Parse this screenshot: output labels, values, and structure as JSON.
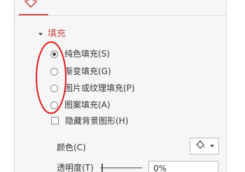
{
  "fill_section": {
    "title": "填充",
    "options": [
      {
        "label": "纯色填充(S)",
        "checked": true
      },
      {
        "label": "渐变填充(G)",
        "checked": false
      },
      {
        "label": "图片或纹理填充(P)",
        "checked": false
      },
      {
        "label": "图案填充(A)",
        "checked": false
      }
    ],
    "hide_background": {
      "label": "隐藏背景图形(H)",
      "checked": false
    }
  },
  "color": {
    "label": "颜色(C)",
    "icon": "paint-bucket-icon"
  },
  "transparency": {
    "label": "透明度(T)",
    "value": "0%",
    "slider_fraction": 0
  },
  "colors": {
    "accent": "#c0504d",
    "annotation": "#e02020",
    "panel_bg": "#f6f6f6"
  }
}
